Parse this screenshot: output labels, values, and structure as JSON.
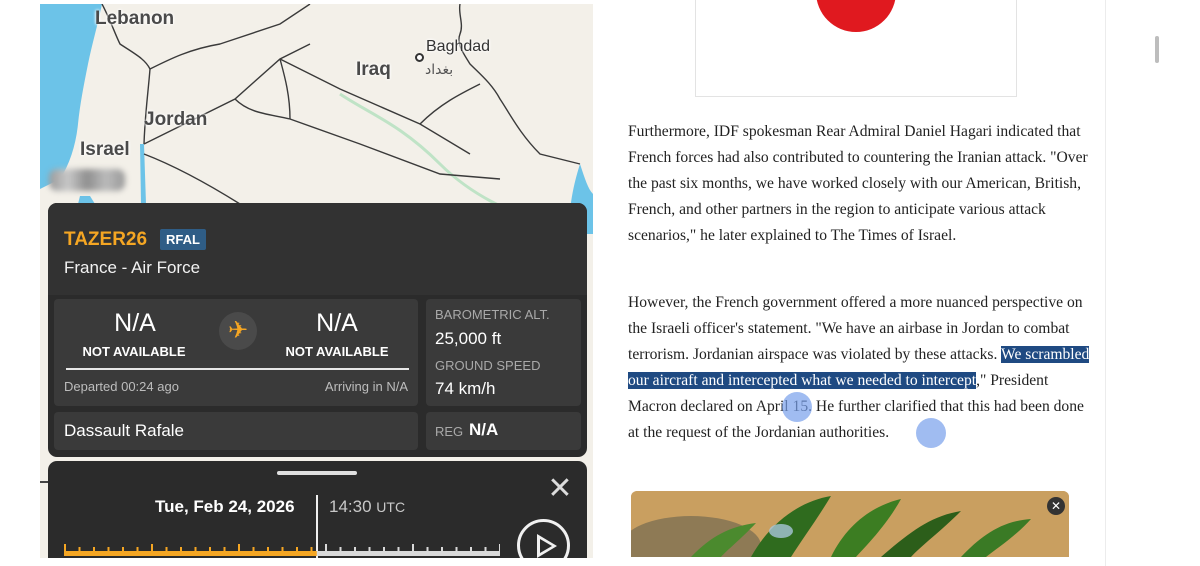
{
  "map": {
    "labels": {
      "lebanon": "Lebanon",
      "iraq": "Iraq",
      "baghdad": "Baghdad",
      "baghdad_ar": "بغداد",
      "jordan": "Jordan",
      "israel": "Israel"
    },
    "colors": {
      "land": "#f3f0e9",
      "water": "#6cc3e8",
      "border": "#3a3a3a"
    }
  },
  "flight": {
    "callsign": "TAZER26",
    "type_code": "RFAL",
    "operator": "France - Air Force",
    "origin": {
      "code": "N/A",
      "name": "NOT AVAILABLE",
      "status": "Departed 00:24 ago"
    },
    "destination": {
      "code": "N/A",
      "name": "NOT AVAILABLE",
      "status": "Arriving in N/A"
    },
    "baro_alt_label": "BAROMETRIC ALT.",
    "baro_alt_value": "25,000 ft",
    "ground_speed_label": "GROUND SPEED",
    "ground_speed_value": "74 km/h",
    "aircraft": "Dassault Rafale",
    "reg_label": "REG",
    "reg_value": "N/A",
    "plane_icon": "airplane-icon",
    "colors": {
      "accent": "#f5a623",
      "panel": "#2b2b2b",
      "badge": "#2f5d86"
    }
  },
  "playback": {
    "date": "Tue, Feb 24, 2026",
    "time": "14:30",
    "time_unit": "UTC",
    "progress": 0.58,
    "colors": {
      "played": "#f5a623",
      "unplayed": "#d9d9d9"
    }
  },
  "article": {
    "para1": "Furthermore, IDF spokesman Rear Admiral Daniel Hagari indicated that French forces had also contributed to countering the Iranian attack. \"Over the past six months, we have worked closely with our American, British, French, and other partners in the region to anticipate various attack scenarios,\" he later explained to The Times of Israel.",
    "para2_before": "However, the French government offered a more nuanced perspective on the Israeli officer's statement. \"We have an airbase in Jordan to combat terrorism. Jordanian airspace was violated by these attacks. ",
    "para2_highlight": "We scrambled our aircraft and intercepted what we needed to intercept",
    "para2_after": ",\" President Macron declared on April 15. He further clarified that this had been done at the request of the Jordanian authorities.",
    "highlight_color": "#1f4a82"
  }
}
